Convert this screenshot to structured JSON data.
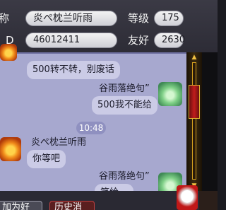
{
  "profile": {
    "name_label": "称",
    "name_value": "炎ぺ枕兰听雨",
    "level_label": "等级",
    "level_value": "175",
    "id_label": "D",
    "id_value": "46012411",
    "friendship_label": "友好",
    "friendship_value": "2630"
  },
  "messages": [
    {
      "sender": "",
      "text": "500转不转，别废话",
      "side": "left"
    },
    {
      "sender": "谷雨落绝句”",
      "text": "500我不能给",
      "side": "right"
    },
    {
      "timestamp": "10:48"
    },
    {
      "sender": "炎ぺ枕兰听雨",
      "text": "你等吧",
      "side": "left"
    },
    {
      "sender": "谷雨落绝句”",
      "text": "笑给…",
      "side": "right"
    }
  ],
  "bottom": {
    "add_friend_label": "加为好友",
    "history_label": "历史消息"
  },
  "colors": {
    "chat_bg": "#a7a8cf",
    "bubble_bg": "#cbcbe6",
    "scroll_thumb": "#c01c1c"
  }
}
